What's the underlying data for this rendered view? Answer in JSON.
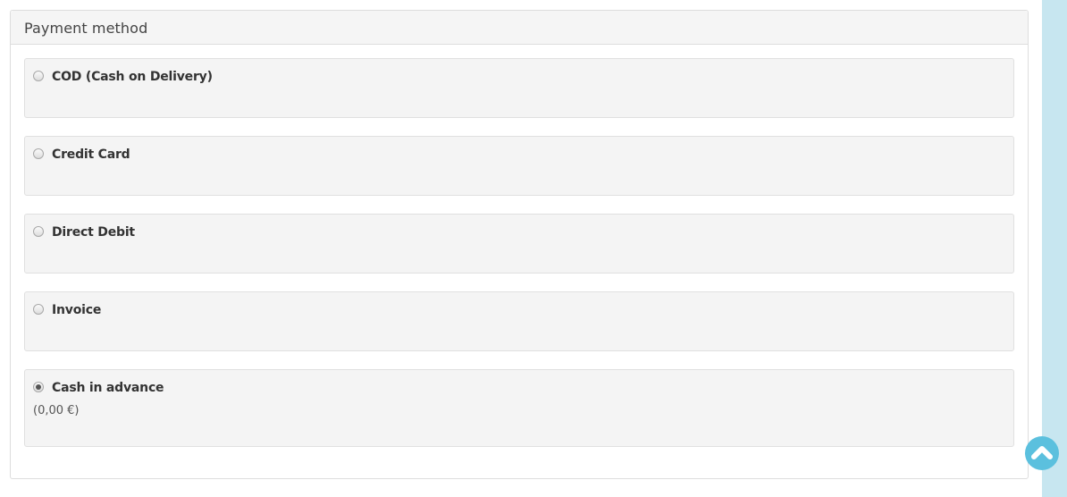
{
  "panel": {
    "title": "Payment method"
  },
  "payment_options": [
    {
      "label": "COD (Cash on Delivery)",
      "selected": false
    },
    {
      "label": "Credit Card",
      "selected": false
    },
    {
      "label": "Direct Debit",
      "selected": false
    },
    {
      "label": "Invoice",
      "selected": false
    },
    {
      "label": "Cash in advance",
      "selected": true,
      "fee": "(0,00 €)"
    }
  ],
  "scroll_top": {
    "icon": "chevron-up-icon"
  },
  "colors": {
    "accent": "#5bc0de",
    "side_strip": "#c7e6f0"
  }
}
